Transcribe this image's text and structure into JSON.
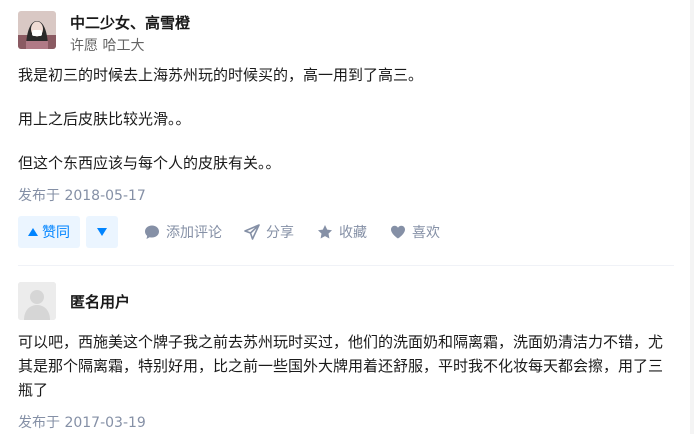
{
  "answer1": {
    "author_name": "中二少女、高雪橙",
    "author_headline": "许愿 哈工大",
    "paragraphs": [
      "我是初三的时候去上海苏州玩的时候买的，高一用到了高三。",
      "用上之后皮肤比较光滑。。",
      "但这个东西应该与每个人的皮肤有关。。"
    ],
    "published": "发布于 2018-05-17",
    "actions": {
      "vote_up_label": "赞同",
      "comment_label": "添加评论",
      "share_label": "分享",
      "favorite_label": "收藏",
      "like_label": "喜欢"
    }
  },
  "answer2": {
    "author_name": "匿名用户",
    "content": "可以吧，西施美这个牌子我之前去苏州玩时买过，他们的洗面奶和隔离霜，洗面奶清洁力不错，尤其是那个隔离霜，特别好用，比之前一些国外大牌用着还舒服，平时我不化妆每天都会擦，用了三瓶了",
    "published": "发布于 2017-03-19"
  },
  "colors": {
    "accent": "#0084ff",
    "accent_bg": "#ebf5ff",
    "meta": "#8590a6"
  }
}
